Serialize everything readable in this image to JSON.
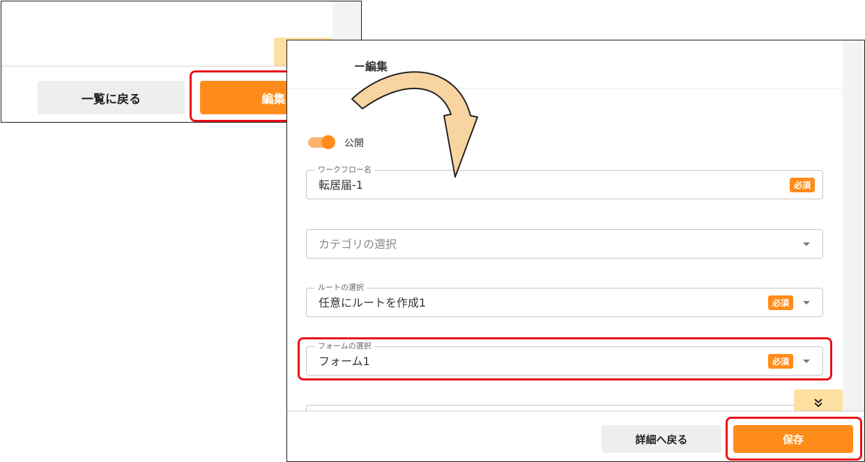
{
  "screen1": {
    "back_to_list_label": "一覧に戻る",
    "edit_label": "編集",
    "expand_icon": "chevron-double-down-icon"
  },
  "screen2": {
    "title": "ー編集",
    "publish_toggle": {
      "label": "公開",
      "on": true
    },
    "workflow_name": {
      "label": "ワークフロー名",
      "value": "転居届-1",
      "required_badge": "必須"
    },
    "category": {
      "placeholder": "カテゴリの選択"
    },
    "route": {
      "label": "ルートの選択",
      "value": "任意にルートを作成1",
      "required_badge": "必須"
    },
    "form": {
      "label": "フォームの選択",
      "value": "フォーム1",
      "required_badge": "必須"
    },
    "expand_icon": "chevron-double-down-icon",
    "back_to_detail_label": "詳細へ戻る",
    "save_label": "保存"
  },
  "colors": {
    "accent": "#ff8c1a",
    "toggle_track": "#ffb36b",
    "expand_tab": "#ffe0a3",
    "highlight": "#e8101a",
    "arrow_fill": "#f7d4a0"
  }
}
